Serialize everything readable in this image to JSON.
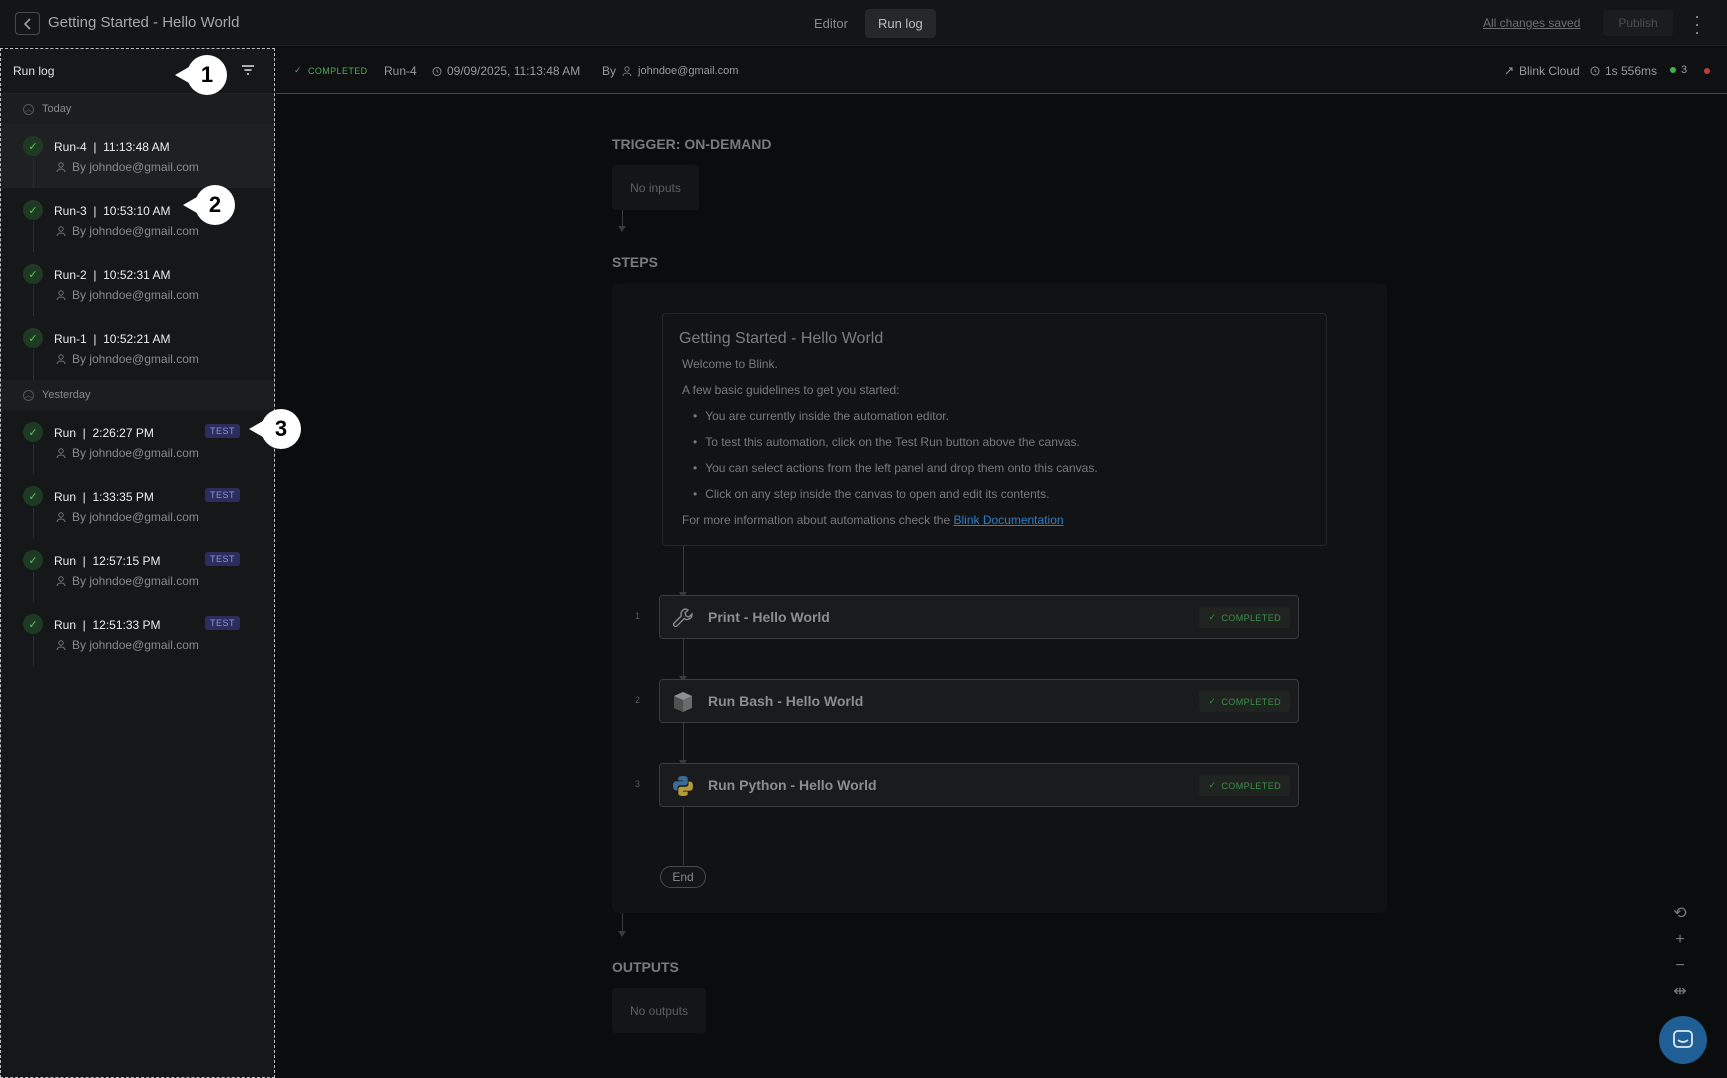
{
  "topbar": {
    "title": "Getting Started - Hello World",
    "tabs": [
      {
        "label": "Editor"
      },
      {
        "label": "Run log"
      }
    ],
    "saved_label": "All changes saved",
    "publish_label": "Publish"
  },
  "sidebar": {
    "title": "Run log",
    "groups": [
      {
        "label": "Today",
        "runs": [
          {
            "title": "Run-4  |  11:13:48 AM",
            "user": "By johndoe@gmail.com"
          },
          {
            "title": "Run-3  |  10:53:10 AM",
            "user": "By johndoe@gmail.com"
          },
          {
            "title": "Run-2  |  10:52:31 AM",
            "user": "By johndoe@gmail.com"
          },
          {
            "title": "Run-1  |  10:52:21 AM",
            "user": "By johndoe@gmail.com"
          }
        ]
      },
      {
        "label": "Yesterday",
        "runs": [
          {
            "title": "Run  |  2:26:27 PM",
            "user": "By johndoe@gmail.com",
            "badge": "TEST"
          },
          {
            "title": "Run  |  1:33:35 PM",
            "user": "By johndoe@gmail.com",
            "badge": "TEST"
          },
          {
            "title": "Run  |  12:57:15 PM",
            "user": "By johndoe@gmail.com",
            "badge": "TEST"
          },
          {
            "title": "Run  |  12:51:33 PM",
            "user": "By johndoe@gmail.com",
            "badge": "TEST"
          }
        ]
      }
    ]
  },
  "callouts": [
    "1",
    "2",
    "3"
  ],
  "statusbar": {
    "status": "COMPLETED",
    "run": "Run-4",
    "timestamp": "09/09/2025, 11:13:48 AM",
    "by_label": "By",
    "email": "johndoe@gmail.com",
    "runner": "Blink Cloud",
    "duration": "1s 556ms",
    "count": "3"
  },
  "canvas": {
    "trigger_label": "TRIGGER: ON-DEMAND",
    "no_inputs": "No inputs",
    "steps_label": "STEPS",
    "outputs_label": "OUTPUTS",
    "no_outputs": "No outputs",
    "note": {
      "title": "Getting Started - Hello World",
      "welcome": "Welcome to Blink.",
      "intro": "A few basic guidelines to get you started:",
      "bullets": [
        "You are currently inside the automation editor.",
        "To test this automation, click on the Test Run button above the canvas.",
        "You can select actions from the left panel and drop them onto this canvas.",
        "Click on any step inside the canvas to open and edit its contents."
      ],
      "more_info": "For more information about automations check the ",
      "link": "Blink Documentation"
    },
    "steps": [
      {
        "num": "1",
        "name": "Print - Hello World",
        "status": "COMPLETED",
        "icon": "wrench-icon"
      },
      {
        "num": "2",
        "name": "Run Bash - Hello World",
        "status": "COMPLETED",
        "icon": "bash-icon"
      },
      {
        "num": "3",
        "name": "Run Python - Hello World",
        "status": "COMPLETED",
        "icon": "python-icon"
      }
    ],
    "end_label": "End"
  },
  "colors": {
    "accent_green": "#4faa5c",
    "test_badge": "#2b2d5c",
    "link_blue": "#2f7ec7",
    "chat_blue": "#1f5f95"
  }
}
